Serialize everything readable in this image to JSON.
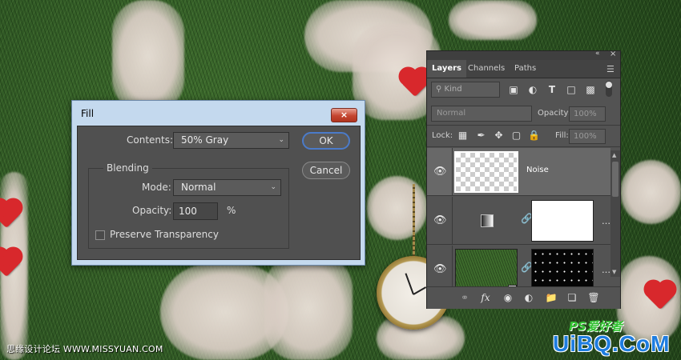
{
  "fill_dialog": {
    "title": "Fill",
    "close_glyph": "×",
    "contents_label": "Contents:",
    "contents_value": "50% Gray",
    "blending_label": "Blending",
    "mode_label": "Mode:",
    "mode_value": "Normal",
    "opacity_label": "Opacity:",
    "opacity_value": "100",
    "opacity_unit": "%",
    "preserve_label": "Preserve Transparency",
    "preserve_checked": false,
    "ok_label": "OK",
    "cancel_label": "Cancel"
  },
  "layers_panel": {
    "tabs": [
      {
        "label": "Layers",
        "active": true
      },
      {
        "label": "Channels",
        "active": false
      },
      {
        "label": "Paths",
        "active": false
      }
    ],
    "filter_kind_placeholder": "Kind",
    "blend_mode": "Normal",
    "opacity_label": "Opacity:",
    "opacity_value": "100%",
    "lock_label": "Lock:",
    "fill_label": "Fill:",
    "fill_value": "100%",
    "layers": [
      {
        "name": "Noise",
        "selected": true
      },
      {
        "name": "",
        "selected": false
      },
      {
        "name": "",
        "selected": false
      }
    ],
    "bottom_icons": [
      "link-icon",
      "fx-icon",
      "mask-icon",
      "adjustment-icon",
      "folder-icon",
      "new-layer-icon",
      "trash-icon"
    ]
  },
  "watermark": {
    "left_text": "思缘设计论坛 WWW.MISSYUAN.COM",
    "logo_top": "PS爱好者",
    "logo_main": "UiBQ.CoM"
  },
  "colors": {
    "dialog_frame": "#c4d9ee",
    "dialog_body": "#505050",
    "ok_border": "#4b7bc9",
    "close_red": "#c44530",
    "panel_bg": "#535353",
    "selected_layer": "#686868"
  }
}
